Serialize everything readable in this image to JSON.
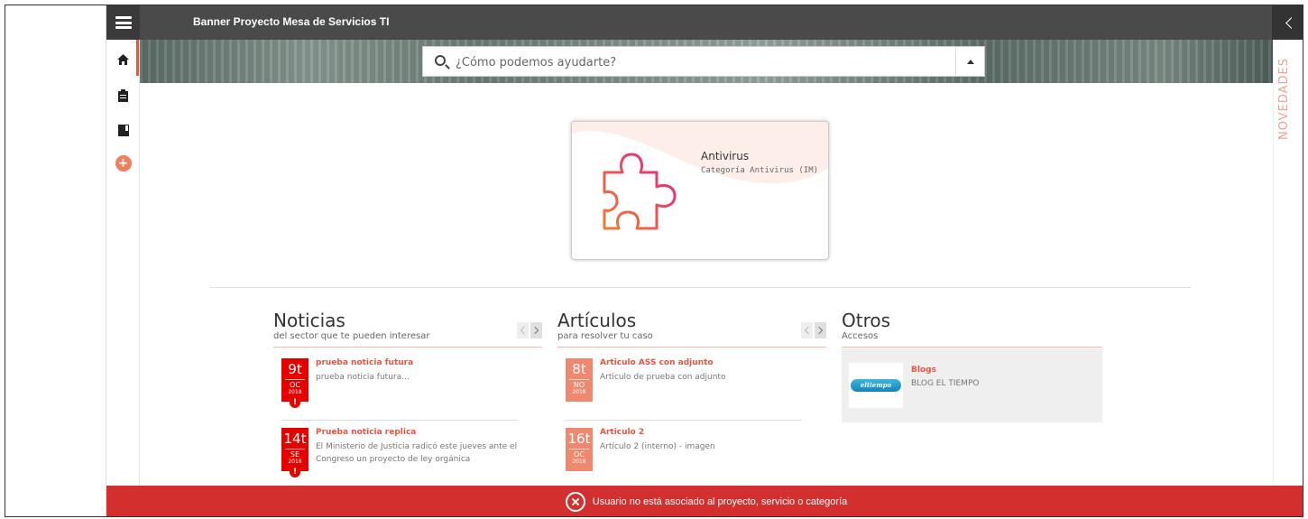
{
  "header": {
    "banner_title": "Banner Proyecto Mesa de Servicios TI"
  },
  "search": {
    "placeholder": "¿Cómo podemos ayudarte?"
  },
  "sidebar": {
    "items": [
      {
        "name": "home",
        "icon": "home-icon"
      },
      {
        "name": "requests",
        "icon": "clipboard-icon"
      },
      {
        "name": "knowledge",
        "icon": "book-icon"
      },
      {
        "name": "add",
        "icon": "plus-icon",
        "label": "+"
      }
    ],
    "accent_color": "#e8543f"
  },
  "novedades": {
    "label": "NOVEDADES"
  },
  "category_card": {
    "title": "Antivirus",
    "subtitle": "Categoría Antivirus (IM)",
    "icon": "puzzle-icon"
  },
  "noticias": {
    "title": "Noticias",
    "subtitle": "del sector que te pueden interesar",
    "items": [
      {
        "day": "9t",
        "month": "OC",
        "year": "2018",
        "title": "prueba noticia futura",
        "desc": "prueba noticia futura...",
        "alert": "!"
      },
      {
        "day": "14t",
        "month": "SE",
        "year": "2018",
        "title": "Prueba noticia replica",
        "desc": "El Ministerio de Justicia radicó este jueves ante el Congreso un proyecto de ley orgánica",
        "alert": "!"
      }
    ]
  },
  "articulos": {
    "title": "Artículos",
    "subtitle": "para resolver tu caso",
    "items": [
      {
        "day": "8t",
        "month": "NO",
        "year": "2018",
        "title": "Articulo ASS con adjunto",
        "desc": "Articulo de prueba con adjunto"
      },
      {
        "day": "16t",
        "month": "OC",
        "year": "2018",
        "title": "Articulo 2",
        "desc": "Artículo 2 (interno) - imagen"
      }
    ]
  },
  "otros": {
    "title": "Otros",
    "subtitle": "Accesos",
    "blog": {
      "logo_text": "eltiempo",
      "title": "Blogs",
      "desc": "BLOG EL TIEMPO"
    }
  },
  "error": {
    "message": "Usuario no está asociado al proyecto, servicio o categoría",
    "color": "#d32f2f"
  }
}
